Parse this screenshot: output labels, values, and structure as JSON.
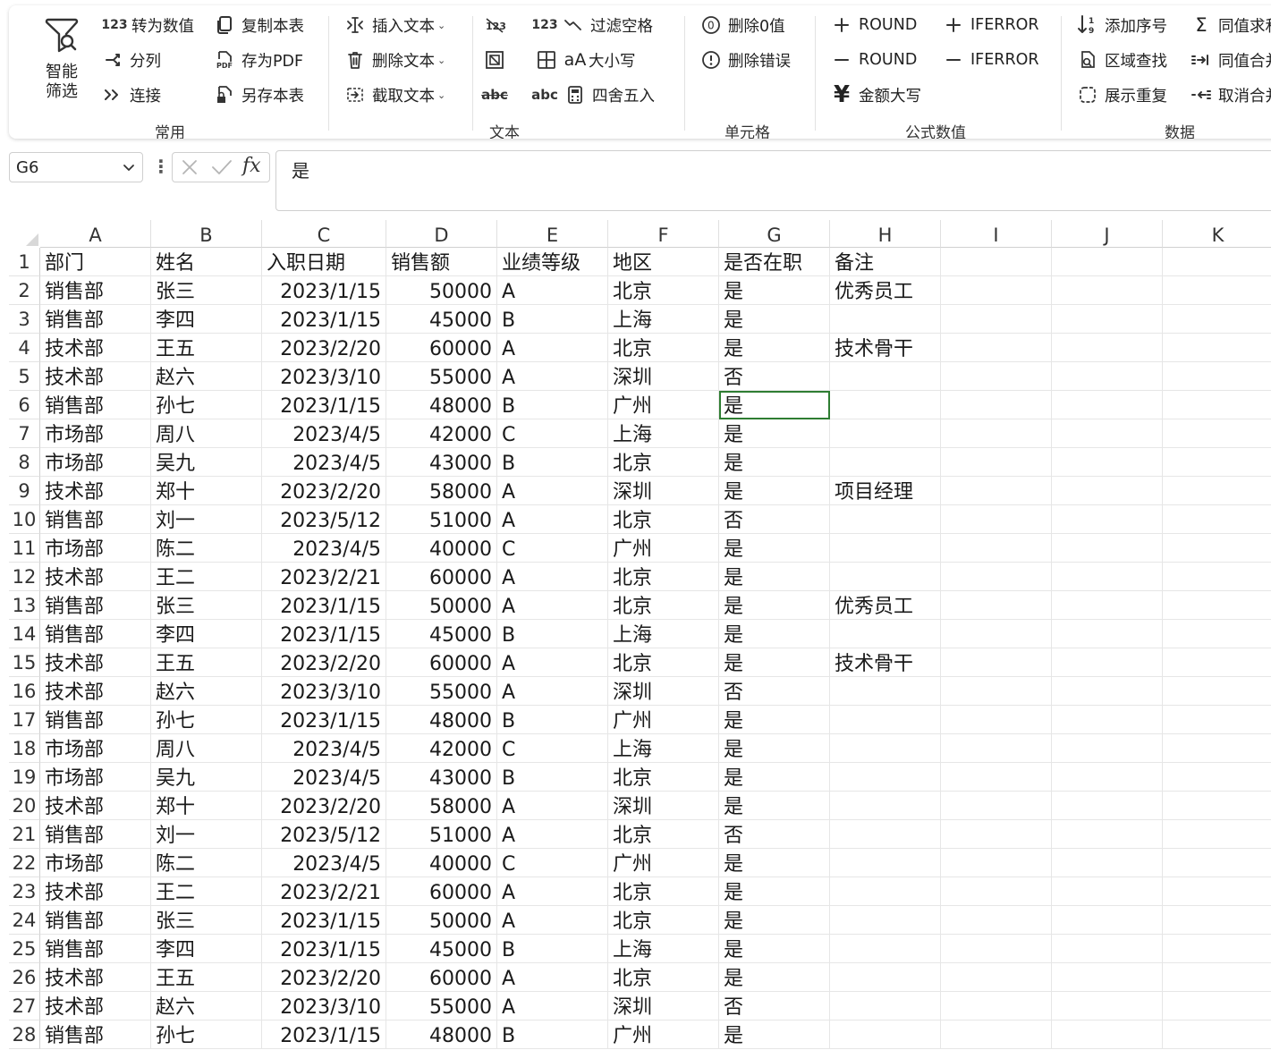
{
  "ribbon": {
    "smart_filter": {
      "line1": "智能",
      "line2": "筛选"
    },
    "items": {
      "to_number": "转为数值",
      "to_number_icon_text": "123",
      "split": "分列",
      "connect": "连接",
      "copy_sheet": "复制本表",
      "save_pdf": "存为PDF",
      "save_sheet": "另存本表",
      "insert_text": "插入文本",
      "delete_text": "删除文本",
      "cut_text": "截取文本",
      "filter_space": "过滤空格",
      "filter_space_icon_text": "123",
      "case": "大小写",
      "round45": "四舍五入",
      "abc_text": "abc",
      "abc2_text": "abc",
      "del_zero": "删除0值",
      "del_error": "删除错误",
      "round_add": "ROUND",
      "round_minus": "ROUND",
      "iferror_add": "IFERROR",
      "iferror_minus": "IFERROR",
      "amount_upper": "金额大写",
      "add_seq": "添加序号",
      "region_search": "区域查找",
      "show_dup": "展示重复",
      "same_sum": "同值求和",
      "same_merge": "同值合并",
      "cancel_merge": "取消合并"
    },
    "groups": {
      "common": "常用",
      "text": "文本",
      "cell": "单元格",
      "formula": "公式数值",
      "data": "数据"
    }
  },
  "formula_bar": {
    "name_box": "G6",
    "fx": "fx",
    "content": "是"
  },
  "grid": {
    "columns": [
      "A",
      "B",
      "C",
      "D",
      "E",
      "F",
      "G",
      "H",
      "I",
      "J",
      "K"
    ],
    "selected_cell": "G6",
    "rows": [
      [
        "部门",
        "姓名",
        "入职日期",
        "销售额",
        "业绩等级",
        "地区",
        "是否在职",
        "备注"
      ],
      [
        "销售部",
        "张三",
        "2023/1/15",
        "50000",
        "A",
        "北京",
        "是",
        "优秀员工"
      ],
      [
        "销售部",
        "李四",
        "2023/1/15",
        "45000",
        "B",
        "上海",
        "是",
        ""
      ],
      [
        "技术部",
        "王五",
        "2023/2/20",
        "60000",
        "A",
        "北京",
        "是",
        "技术骨干"
      ],
      [
        "技术部",
        "赵六",
        "2023/3/10",
        "55000",
        "A",
        "深圳",
        "否",
        ""
      ],
      [
        "销售部",
        "孙七",
        "2023/1/15",
        "48000",
        "B",
        "广州",
        "是",
        ""
      ],
      [
        "市场部",
        "周八",
        "2023/4/5",
        "42000",
        "C",
        "上海",
        "是",
        ""
      ],
      [
        "市场部",
        "吴九",
        "2023/4/5",
        "43000",
        "B",
        "北京",
        "是",
        ""
      ],
      [
        "技术部",
        "郑十",
        "2023/2/20",
        "58000",
        "A",
        "深圳",
        "是",
        "项目经理"
      ],
      [
        "销售部",
        "刘一",
        "2023/5/12",
        "51000",
        "A",
        "北京",
        "否",
        ""
      ],
      [
        "市场部",
        "陈二",
        "2023/4/5",
        "40000",
        "C",
        "广州",
        "是",
        ""
      ],
      [
        "技术部",
        "王二",
        "2023/2/21",
        "60000",
        "A",
        "北京",
        "是",
        ""
      ],
      [
        "销售部",
        "张三",
        "2023/1/15",
        "50000",
        "A",
        "北京",
        "是",
        "优秀员工"
      ],
      [
        "销售部",
        "李四",
        "2023/1/15",
        "45000",
        "B",
        "上海",
        "是",
        ""
      ],
      [
        "技术部",
        "王五",
        "2023/2/20",
        "60000",
        "A",
        "北京",
        "是",
        "技术骨干"
      ],
      [
        "技术部",
        "赵六",
        "2023/3/10",
        "55000",
        "A",
        "深圳",
        "否",
        ""
      ],
      [
        "销售部",
        "孙七",
        "2023/1/15",
        "48000",
        "B",
        "广州",
        "是",
        ""
      ],
      [
        "市场部",
        "周八",
        "2023/4/5",
        "42000",
        "C",
        "上海",
        "是",
        ""
      ],
      [
        "市场部",
        "吴九",
        "2023/4/5",
        "43000",
        "B",
        "北京",
        "是",
        ""
      ],
      [
        "技术部",
        "郑十",
        "2023/2/20",
        "58000",
        "A",
        "深圳",
        "是",
        ""
      ],
      [
        "销售部",
        "刘一",
        "2023/5/12",
        "51000",
        "A",
        "北京",
        "否",
        ""
      ],
      [
        "市场部",
        "陈二",
        "2023/4/5",
        "40000",
        "C",
        "广州",
        "是",
        ""
      ],
      [
        "技术部",
        "王二",
        "2023/2/21",
        "60000",
        "A",
        "北京",
        "是",
        ""
      ],
      [
        "销售部",
        "张三",
        "2023/1/15",
        "50000",
        "A",
        "北京",
        "是",
        ""
      ],
      [
        "销售部",
        "李四",
        "2023/1/15",
        "45000",
        "B",
        "上海",
        "是",
        ""
      ],
      [
        "技术部",
        "王五",
        "2023/2/20",
        "60000",
        "A",
        "北京",
        "是",
        ""
      ],
      [
        "技术部",
        "赵六",
        "2023/3/10",
        "55000",
        "A",
        "深圳",
        "否",
        ""
      ],
      [
        "销售部",
        "孙七",
        "2023/1/15",
        "48000",
        "B",
        "广州",
        "是",
        ""
      ]
    ]
  },
  "colors": {
    "selection": "#2e7d32",
    "grid_line": "#e6e6e6",
    "header_line": "#d0d0d0"
  }
}
